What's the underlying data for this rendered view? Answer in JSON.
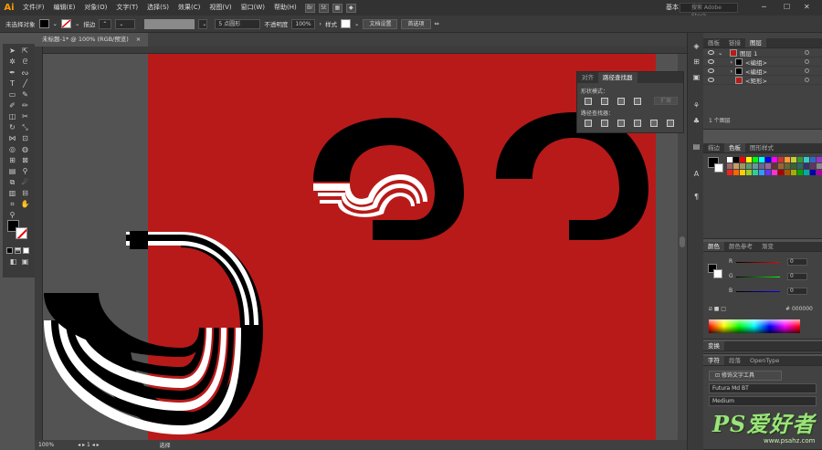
{
  "app": {
    "logo": "Ai",
    "workspace": "基本",
    "search_placeholder": "搜索 Adobe Stock"
  },
  "menu": [
    "文件(F)",
    "编辑(E)",
    "对象(O)",
    "文字(T)",
    "选择(S)",
    "效果(C)",
    "视图(V)",
    "窗口(W)",
    "帮助(H)"
  ],
  "control_bar": {
    "selection": "未选择对象",
    "stroke_label": "描边",
    "brush": "5 点圆形",
    "opacity_label": "不透明度",
    "opacity": "100%",
    "style_label": "样式",
    "doc_settings": "文档设置",
    "preferences": "首选项"
  },
  "document": {
    "tab": "未标题-1* @ 100% (RGB/预览)",
    "close": "×",
    "zoom": "100%",
    "status": "选择"
  },
  "pathfinder": {
    "tabs": [
      "对齐",
      "路径查找器"
    ],
    "shape_modes": "形状模式：",
    "pathfinders": "路径查找器：",
    "expand": "扩展"
  },
  "layers_panel": {
    "tabs": [
      "画板",
      "链接",
      "图层"
    ],
    "rows": [
      "图层 1",
      "<编组>",
      "<编组>",
      "<矩形>"
    ],
    "footer": "1 个图层"
  },
  "swatch_panel": {
    "tabs": [
      "描边",
      "色板",
      "图形样式"
    ]
  },
  "color_panel": {
    "tabs": [
      "颜色",
      "颜色参考",
      "渐变"
    ],
    "channels": [
      {
        "name": "R",
        "value": "0"
      },
      {
        "name": "G",
        "value": "0"
      },
      {
        "name": "B",
        "value": "0"
      }
    ],
    "hex": "000000"
  },
  "transform_panel": {
    "tabs": [
      "变换"
    ]
  },
  "character_panel": {
    "tabs": [
      "字符",
      "段落",
      "OpenType"
    ],
    "touch_tool": "修饰文字工具",
    "font": "Futura Md BT",
    "style": "Medium"
  },
  "colors": {
    "artboard": "#b81a1a",
    "accent": "#ff9a00"
  },
  "watermark": {
    "logo": "PS爱好者",
    "url": "www.psahz.com"
  }
}
